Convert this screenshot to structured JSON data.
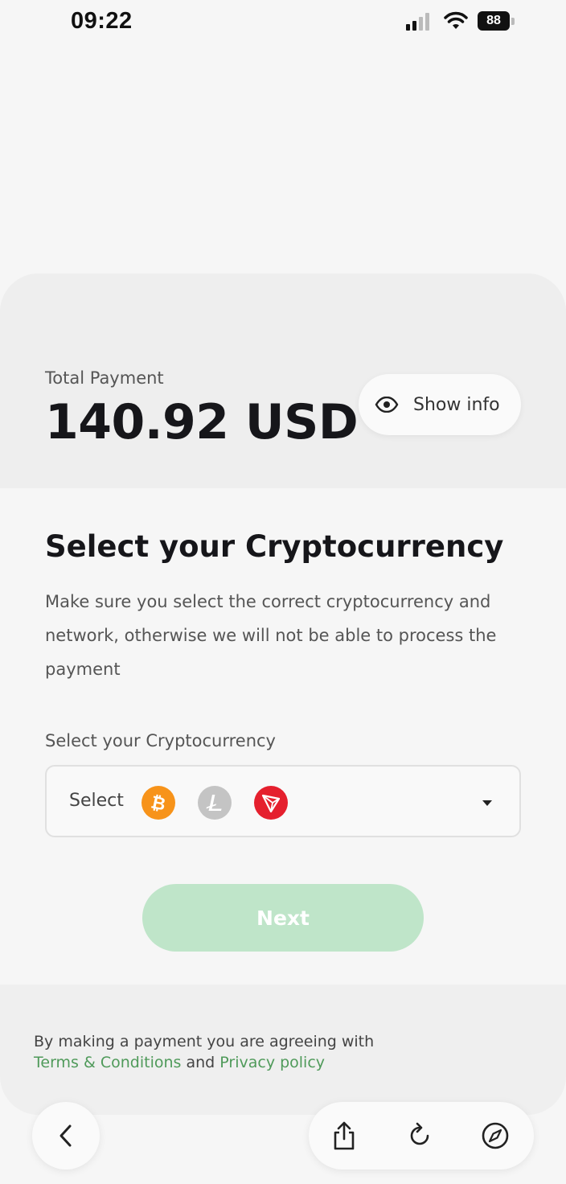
{
  "status_bar": {
    "time": "09:22",
    "battery": "88"
  },
  "payment": {
    "total_label": "Total Payment",
    "total_amount": "140.92 USD",
    "show_info_label": "Show info"
  },
  "crypto_section": {
    "title": "Select your Cryptocurrency",
    "description": "Make sure you select the correct cryptocurrency and network, otherwise we will not be able to process the payment",
    "field_label": "Select your Cryptocurrency",
    "select_placeholder": "Select",
    "coins": [
      {
        "name": "bitcoin",
        "color": "#f7931a"
      },
      {
        "name": "litecoin",
        "color": "#c4c4c4"
      },
      {
        "name": "tron",
        "color": "#e5202e"
      }
    ],
    "next_label": "Next"
  },
  "footer": {
    "agreement_text": "By making a payment you are agreeing with",
    "terms_link": "Terms & Conditions",
    "and_text": "and",
    "privacy_link": "Privacy policy"
  },
  "colors": {
    "accent_green": "#4f9a5a",
    "button_disabled": "#bfe5c9"
  },
  "browser_toolbar": {
    "icons": [
      "back-icon",
      "share-icon",
      "reload-icon",
      "compass-icon"
    ]
  }
}
